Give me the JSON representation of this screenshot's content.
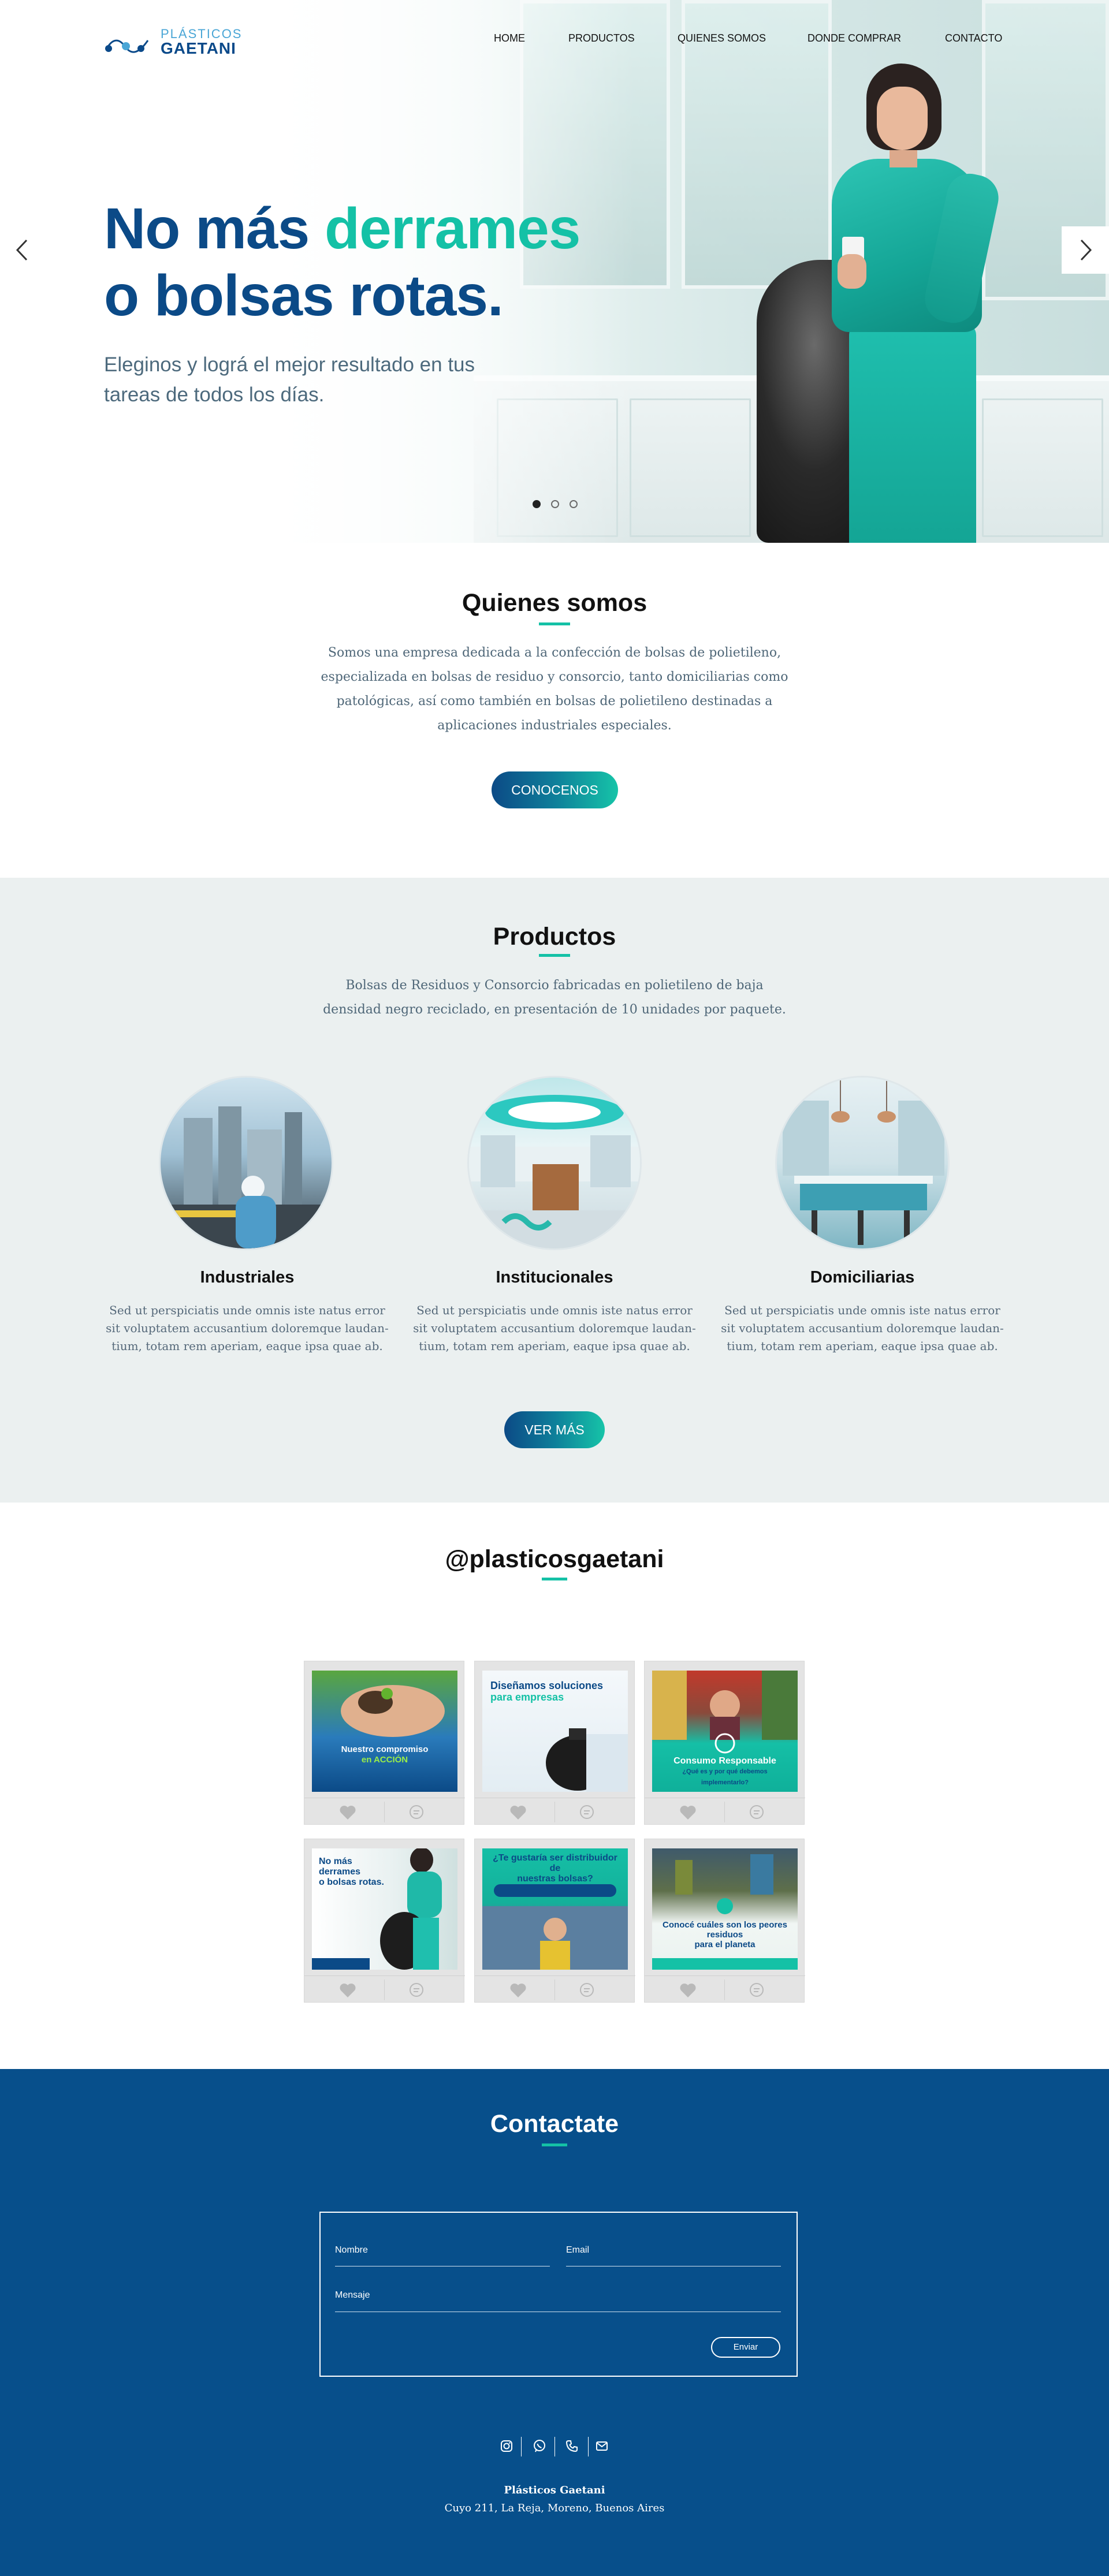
{
  "brand": {
    "logo_line1": "PLÁSTICOS",
    "logo_line2": "GAETANI",
    "primary_color": "#0b4a87",
    "accent_color": "#14c1a6",
    "footer_bg": "#074f8b"
  },
  "nav": {
    "items": [
      "HOME",
      "PRODUCTOS",
      "QUIENES SOMOS",
      "DONDE COMPRAR",
      "CONTACTO"
    ]
  },
  "hero": {
    "title_line1_a": "No más ",
    "title_line1_b": "derrames",
    "title_line2": "o bolsas rotas.",
    "subtitle": "Eleginos y lográ el mejor resultado en tus tareas de todos los días.",
    "slides_total": 3,
    "active_slide": 1,
    "prev_icon": "chevron-left-icon",
    "next_icon": "chevron-right-icon"
  },
  "about": {
    "title": "Quienes somos",
    "text": "Somos una empresa dedicada a la confección de bolsas de polietileno, especializada en bolsas de residuo y consorcio, tanto domiciliarias como patológicas, así como también en bolsas de polietileno destinadas a aplicaciones industriales especiales.",
    "button": "CONOCENOS"
  },
  "products": {
    "title": "Productos",
    "intro": "Bolsas de Residuos y Consorcio fabricadas en polietileno de baja densidad negro reciclado, en presentación de 10 unidades por paquete.",
    "items": [
      {
        "name": "Industriales",
        "text": "Sed ut perspiciatis unde omnis iste natus error sit voluptatem accusantium doloremque laudan- tium, totam rem aperiam, eaque ipsa quae ab."
      },
      {
        "name": "Institucionales",
        "text": "Sed ut perspiciatis unde omnis iste natus error sit voluptatem accusantium doloremque laudan- tium, totam rem aperiam, eaque ipsa quae ab."
      },
      {
        "name": "Domiciliarias",
        "text": "Sed ut perspiciatis unde omnis iste natus error sit voluptatem accusantium doloremque laudan- tium, totam rem aperiam, eaque ipsa quae ab."
      }
    ],
    "button": "VER MÁS"
  },
  "instagram": {
    "handle": "@plasticosgaetani",
    "posts": [
      {
        "line1": "Nuestro compromiso",
        "line2": "en ACCIÓN"
      },
      {
        "line1": "Diseñamos soluciones",
        "line2": "para empresas"
      },
      {
        "line1": "Consumo Responsable",
        "line2": "¿Qué es y por qué debemos implementarlo?"
      },
      {
        "line1": "No más derrames",
        "line2": "o bolsas rotas."
      },
      {
        "line1": "¿Te gustaría ser distribuidor de",
        "line2": "nuestras bolsas?"
      },
      {
        "line1": "Conocé cuáles son los peores residuos",
        "line2": "para el planeta"
      }
    ]
  },
  "contact": {
    "title": "Contactate",
    "name_label": "Nombre",
    "email_label": "Email",
    "message_label": "Mensaje",
    "send_button": "Enviar",
    "social_icons": [
      "instagram-icon",
      "whatsapp-icon",
      "phone-icon",
      "mail-icon"
    ],
    "company": "Plásticos Gaetani",
    "address": "Cuyo 211, La Reja, Moreno, Buenos Aires"
  }
}
